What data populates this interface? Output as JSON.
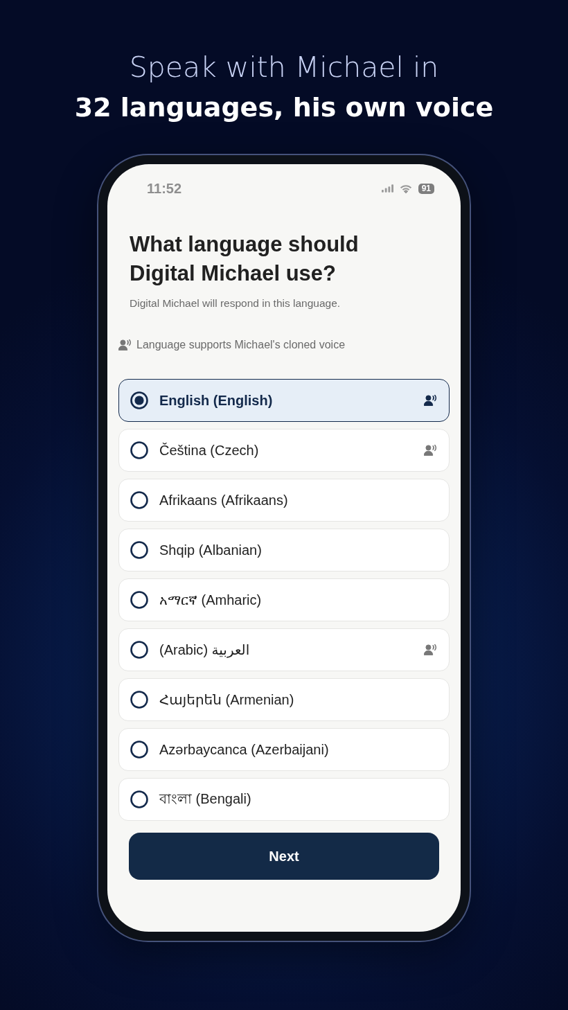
{
  "headline": {
    "intro": "Speak with Michael in",
    "highlight": "32 languages, his own voice"
  },
  "status_bar": {
    "time": "11:52",
    "battery": "91"
  },
  "title": "What language should Digital Michael use?",
  "subtitle": "Digital Michael will respond in this language.",
  "legend": "Language supports Michael's cloned voice",
  "languages": [
    {
      "label": "English (English)",
      "selected": true,
      "cloned_voice": true
    },
    {
      "label": "Čeština (Czech)",
      "selected": false,
      "cloned_voice": true
    },
    {
      "label": "Afrikaans (Afrikaans)",
      "selected": false,
      "cloned_voice": false
    },
    {
      "label": "Shqip (Albanian)",
      "selected": false,
      "cloned_voice": false
    },
    {
      "label": "አማርኛ (Amharic)",
      "selected": false,
      "cloned_voice": false
    },
    {
      "label": "العربية (Arabic)",
      "selected": false,
      "cloned_voice": true
    },
    {
      "label": "Հայերեն (Armenian)",
      "selected": false,
      "cloned_voice": false
    },
    {
      "label": "Azərbaycanca (Azerbaijani)",
      "selected": false,
      "cloned_voice": false
    },
    {
      "label": "বাংলা (Bengali)",
      "selected": false,
      "cloned_voice": false
    }
  ],
  "next_button": "Next"
}
